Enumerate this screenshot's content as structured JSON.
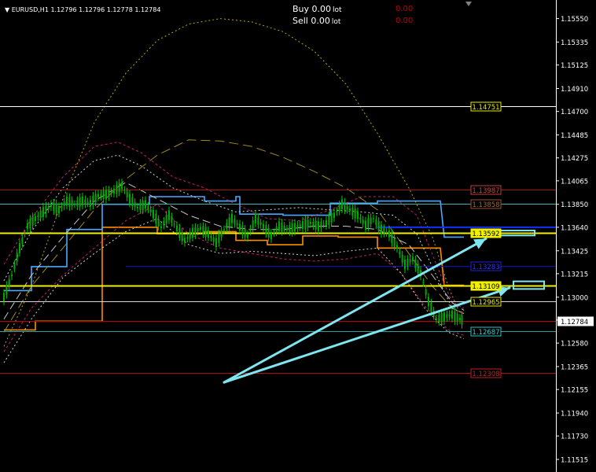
{
  "header": {
    "symbol_line": "EURUSD,H1  1.12796 1.12796 1.12778 1.12784",
    "buy_label": "Buy 0.00",
    "sell_label": "Sell 0.00",
    "lot_unit": "lot",
    "buy_pnl": "0.00",
    "sell_pnl": "0.00"
  },
  "colors": {
    "background": "#000000",
    "candles": "#00cc00",
    "axis_text": "#ffffff",
    "arrow": "#7fe6f0"
  },
  "chart_data": {
    "type": "line",
    "title": "",
    "symbol": "EURUSD",
    "timeframe": "H1",
    "ylim": [
      1.114,
      1.1572
    ],
    "y_ticks": [
      "1.15550",
      "1.15335",
      "1.15125",
      "1.14910",
      "1.14700",
      "1.14485",
      "1.14275",
      "1.14065",
      "1.13850",
      "1.13640",
      "1.13425",
      "1.13215",
      "1.13000",
      "1.12790",
      "1.12580",
      "1.12365",
      "1.12155",
      "1.11940",
      "1.11730",
      "1.11515"
    ],
    "current_price": {
      "value": 1.12784,
      "label": "1.12784"
    },
    "price_levels": [
      {
        "label": "1.14751",
        "value": 1.14751,
        "line_color": "#ffffff",
        "box_color": "#e8e800",
        "text_color": "#e8e800",
        "x_start": 0
      },
      {
        "label": "1.13987",
        "value": 1.13987,
        "line_color": "#a01818",
        "box_color": "#c04040",
        "text_color": "#d04040",
        "x_start": 0
      },
      {
        "label": "1.13858",
        "value": 1.13858,
        "line_color": "#40b0b0",
        "box_color": "#a0522d",
        "text_color": "#a06a30",
        "x_start": 0
      },
      {
        "label": "1.13592",
        "value": 1.13592,
        "line_color": "#f0f000",
        "box_color": "#f0f000",
        "text_color": "#000000",
        "box_fill": "#f0f000",
        "x_start": 0
      },
      {
        "label": "1.13283",
        "value": 1.13283,
        "line_color": "#1010c0",
        "box_color": "#2020e0",
        "text_color": "#3030ff",
        "x_start": 160
      },
      {
        "label": "1.13109",
        "value": 1.13109,
        "line_color": "#f0f000",
        "box_color": "#f0f000",
        "text_color": "#000000",
        "box_fill": "#f0f000",
        "x_start": 0
      },
      {
        "label": "1.12965",
        "value": 1.12965,
        "line_color": "#d8d8d8",
        "box_color": "#e8e800",
        "text_color": "#e8e800",
        "x_start": 0
      },
      {
        "label": "1.12687",
        "value": 1.12687,
        "line_color": "#30a0a0",
        "box_color": "#30c0c0",
        "text_color": "#30d0d0",
        "x_start": 0
      },
      {
        "label": "1.12308",
        "value": 1.12308,
        "line_color": "#b01010",
        "box_color": "#c02020",
        "text_color": "#c02020",
        "x_start": 0
      }
    ],
    "series": [
      {
        "role": "price",
        "color": "#00cc00",
        "points": [
          [
            5,
            1.13
          ],
          [
            15,
            1.132
          ],
          [
            25,
            1.1345
          ],
          [
            35,
            1.1365
          ],
          [
            45,
            1.1372
          ],
          [
            55,
            1.1378
          ],
          [
            65,
            1.1384
          ],
          [
            75,
            1.138
          ],
          [
            85,
            1.1388
          ],
          [
            95,
            1.1385
          ],
          [
            105,
            1.1388
          ],
          [
            115,
            1.1386
          ],
          [
            125,
            1.1393
          ],
          [
            135,
            1.1394
          ],
          [
            145,
            1.1397
          ],
          [
            155,
            1.1402
          ],
          [
            165,
            1.139
          ],
          [
            175,
            1.1382
          ],
          [
            185,
            1.1385
          ],
          [
            195,
            1.1376
          ],
          [
            205,
            1.1364
          ],
          [
            215,
            1.1375
          ],
          [
            225,
            1.1363
          ],
          [
            235,
            1.1352
          ],
          [
            245,
            1.1359
          ],
          [
            255,
            1.1363
          ],
          [
            265,
            1.1358
          ],
          [
            275,
            1.135
          ],
          [
            285,
            1.1362
          ],
          [
            295,
            1.1372
          ],
          [
            305,
            1.1364
          ],
          [
            315,
            1.1356
          ],
          [
            325,
            1.1372
          ],
          [
            335,
            1.1365
          ],
          [
            345,
            1.1356
          ],
          [
            355,
            1.1365
          ],
          [
            365,
            1.1362
          ],
          [
            375,
            1.1364
          ],
          [
            385,
            1.1366
          ],
          [
            395,
            1.1368
          ],
          [
            405,
            1.1365
          ],
          [
            415,
            1.1368
          ],
          [
            425,
            1.1375
          ],
          [
            435,
            1.1385
          ],
          [
            445,
            1.138
          ],
          [
            455,
            1.1375
          ],
          [
            465,
            1.1366
          ],
          [
            475,
            1.1372
          ],
          [
            485,
            1.1362
          ],
          [
            495,
            1.1358
          ],
          [
            505,
            1.1346
          ],
          [
            515,
            1.133
          ],
          [
            525,
            1.1335
          ],
          [
            535,
            1.1322
          ],
          [
            545,
            1.1296
          ],
          [
            555,
            1.128
          ],
          [
            565,
            1.1282
          ],
          [
            575,
            1.1284
          ],
          [
            585,
            1.128
          ],
          [
            590,
            1.12784
          ]
        ]
      },
      {
        "role": "channel",
        "color": "#ff8c00",
        "dash": "",
        "points": [
          [
            5,
            1.127
          ],
          [
            45,
            1.127
          ],
          [
            45,
            1.1278
          ],
          [
            130,
            1.1278
          ],
          [
            130,
            1.1364
          ],
          [
            200,
            1.1364
          ],
          [
            200,
            1.1358
          ],
          [
            260,
            1.1358
          ],
          [
            260,
            1.136
          ],
          [
            300,
            1.136
          ],
          [
            300,
            1.1352
          ],
          [
            340,
            1.1352
          ],
          [
            340,
            1.1348
          ],
          [
            385,
            1.1348
          ],
          [
            385,
            1.1356
          ],
          [
            430,
            1.1356
          ],
          [
            430,
            1.1355
          ],
          [
            480,
            1.1355
          ],
          [
            480,
            1.1345
          ],
          [
            560,
            1.1345
          ],
          [
            565,
            1.1311
          ],
          [
            590,
            1.1311
          ]
        ]
      },
      {
        "role": "channel",
        "color": "#4aa8ff",
        "dash": "",
        "points": [
          [
            5,
            1.1306
          ],
          [
            40,
            1.1306
          ],
          [
            40,
            1.1328
          ],
          [
            85,
            1.1328
          ],
          [
            85,
            1.1362
          ],
          [
            130,
            1.1362
          ],
          [
            130,
            1.1385
          ],
          [
            190,
            1.1385
          ],
          [
            190,
            1.1392
          ],
          [
            260,
            1.1392
          ],
          [
            260,
            1.1388
          ],
          [
            300,
            1.1388
          ],
          [
            300,
            1.1392
          ],
          [
            305,
            1.1392
          ],
          [
            305,
            1.1376
          ],
          [
            360,
            1.1376
          ],
          [
            360,
            1.1375
          ],
          [
            420,
            1.1375
          ],
          [
            420,
            1.1386
          ],
          [
            480,
            1.1386
          ],
          [
            480,
            1.1388
          ],
          [
            560,
            1.1388
          ],
          [
            565,
            1.1355
          ],
          [
            590,
            1.1355
          ]
        ]
      },
      {
        "role": "envelope",
        "color": "#b8a800",
        "dash": "2,3",
        "points": [
          [
            5,
            1.1255
          ],
          [
            40,
            1.131
          ],
          [
            80,
            1.139
          ],
          [
            120,
            1.146
          ],
          [
            160,
            1.1505
          ],
          [
            200,
            1.1535
          ],
          [
            240,
            1.155
          ],
          [
            280,
            1.1555
          ],
          [
            320,
            1.1552
          ],
          [
            360,
            1.1543
          ],
          [
            400,
            1.1525
          ],
          [
            440,
            1.1495
          ],
          [
            480,
            1.145
          ],
          [
            520,
            1.14
          ],
          [
            550,
            1.1355
          ],
          [
            570,
            1.131
          ],
          [
            585,
            1.1285
          ]
        ]
      },
      {
        "role": "envelope",
        "color": "#a08a20",
        "dash": "12,6",
        "points": [
          [
            5,
            1.1268
          ],
          [
            40,
            1.131
          ],
          [
            80,
            1.1345
          ],
          [
            120,
            1.138
          ],
          [
            160,
            1.1408
          ],
          [
            200,
            1.143
          ],
          [
            240,
            1.1444
          ],
          [
            280,
            1.1443
          ],
          [
            320,
            1.1438
          ],
          [
            360,
            1.1428
          ],
          [
            400,
            1.1415
          ],
          [
            440,
            1.14
          ],
          [
            480,
            1.138
          ],
          [
            520,
            1.134
          ],
          [
            550,
            1.131
          ],
          [
            575,
            1.129
          ],
          [
            590,
            1.1285
          ]
        ]
      },
      {
        "role": "envelope",
        "color": "#c81e6e",
        "dash": "3,3",
        "points": [
          [
            5,
            1.133
          ],
          [
            40,
            1.1372
          ],
          [
            80,
            1.141
          ],
          [
            120,
            1.1438
          ],
          [
            150,
            1.1442
          ],
          [
            180,
            1.1432
          ],
          [
            220,
            1.141
          ],
          [
            260,
            1.14
          ],
          [
            300,
            1.1385
          ],
          [
            340,
            1.1372
          ],
          [
            380,
            1.137
          ],
          [
            420,
            1.138
          ],
          [
            460,
            1.1392
          ],
          [
            500,
            1.1392
          ],
          [
            530,
            1.1375
          ],
          [
            555,
            1.133
          ],
          [
            575,
            1.1295
          ],
          [
            590,
            1.129
          ]
        ]
      },
      {
        "role": "envelope",
        "color": "#c81e6e",
        "dash": "3,3",
        "points": [
          [
            5,
            1.125
          ],
          [
            40,
            1.129
          ],
          [
            80,
            1.132
          ],
          [
            120,
            1.1345
          ],
          [
            160,
            1.137
          ],
          [
            200,
            1.1385
          ],
          [
            240,
            1.1358
          ],
          [
            280,
            1.1345
          ],
          [
            320,
            1.134
          ],
          [
            360,
            1.1335
          ],
          [
            400,
            1.1333
          ],
          [
            440,
            1.1335
          ],
          [
            480,
            1.134
          ],
          [
            510,
            1.1322
          ],
          [
            540,
            1.1292
          ],
          [
            570,
            1.127
          ],
          [
            590,
            1.1265
          ]
        ]
      },
      {
        "role": "envelope",
        "color": "#d0d0d0",
        "dash": "2,3",
        "points": [
          [
            5,
            1.1315
          ],
          [
            40,
            1.136
          ],
          [
            80,
            1.14
          ],
          [
            120,
            1.1425
          ],
          [
            150,
            1.143
          ],
          [
            180,
            1.142
          ],
          [
            220,
            1.14
          ],
          [
            260,
            1.1388
          ],
          [
            300,
            1.1378
          ],
          [
            340,
            1.138
          ],
          [
            380,
            1.1382
          ],
          [
            420,
            1.138
          ],
          [
            460,
            1.1378
          ],
          [
            500,
            1.1375
          ],
          [
            530,
            1.1358
          ],
          [
            555,
            1.132
          ],
          [
            575,
            1.129
          ],
          [
            590,
            1.1285
          ]
        ]
      },
      {
        "role": "envelope",
        "color": "#d0d0d0",
        "dash": "2,3",
        "points": [
          [
            5,
            1.124
          ],
          [
            40,
            1.128
          ],
          [
            80,
            1.1318
          ],
          [
            120,
            1.134
          ],
          [
            160,
            1.136
          ],
          [
            200,
            1.1372
          ],
          [
            240,
            1.1348
          ],
          [
            280,
            1.134
          ],
          [
            320,
            1.1342
          ],
          [
            360,
            1.134
          ],
          [
            400,
            1.1338
          ],
          [
            440,
            1.1342
          ],
          [
            480,
            1.1345
          ],
          [
            510,
            1.1322
          ],
          [
            540,
            1.129
          ],
          [
            570,
            1.1268
          ],
          [
            590,
            1.1262
          ]
        ]
      },
      {
        "role": "envelope",
        "color": "#c8c8c8",
        "dash": "10,5",
        "points": [
          [
            5,
            1.128
          ],
          [
            40,
            1.132
          ],
          [
            80,
            1.1355
          ],
          [
            120,
            1.1388
          ],
          [
            160,
            1.1405
          ],
          [
            200,
            1.139
          ],
          [
            240,
            1.1375
          ],
          [
            280,
            1.1365
          ],
          [
            320,
            1.1362
          ],
          [
            360,
            1.1362
          ],
          [
            400,
            1.1365
          ],
          [
            440,
            1.1365
          ],
          [
            480,
            1.1362
          ],
          [
            520,
            1.1348
          ],
          [
            550,
            1.132
          ],
          [
            575,
            1.1295
          ],
          [
            590,
            1.1288
          ]
        ]
      }
    ],
    "arrows": [
      {
        "from": [
          285,
          1.1222
        ],
        "to": [
          618,
          1.13535
        ]
      },
      {
        "from": [
          285,
          1.1222
        ],
        "to": [
          648,
          1.13085
        ]
      }
    ],
    "highlight_boxes": [
      {
        "y_top": 1.1361,
        "y_bottom": 1.13565,
        "x_start": 636,
        "x_end": 680
      },
      {
        "y_top": 1.13145,
        "y_bottom": 1.13075,
        "x_start": 653,
        "x_end": 692
      }
    ]
  }
}
